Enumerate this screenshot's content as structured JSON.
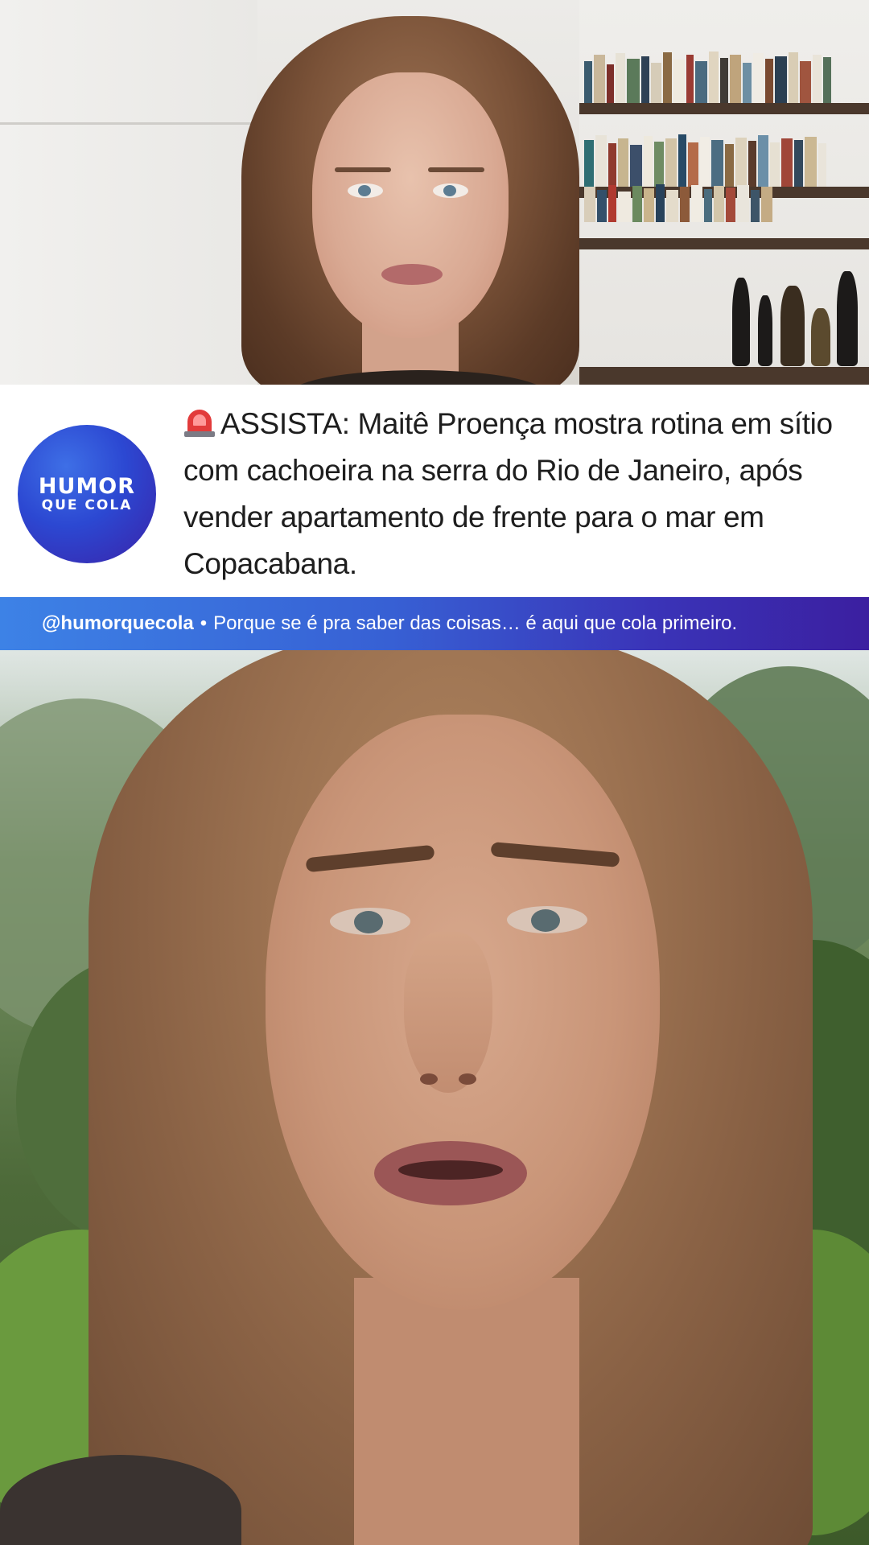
{
  "headline": {
    "alert_icon": "siren-icon",
    "text": "ASSISTA: Maitê Proença mostra rotina em sítio com cachoeira na serra do Rio de Janeiro, após vender apartamento de frente para o mar em Copacabana."
  },
  "logo": {
    "line1": "HUMOR",
    "line2": "QUE COLA"
  },
  "banner": {
    "handle": "@humorquecola",
    "separator": "•",
    "tagline": "Porque se é pra saber das coisas… é aqui que cola primeiro."
  },
  "colors": {
    "logo_blue": "#2c48d2",
    "logo_purple": "#3a22a8",
    "banner_start": "#3d82e6",
    "banner_end": "#3b1fa0",
    "headline_text": "#1e1e1e",
    "siren_red": "#e23b3b"
  }
}
